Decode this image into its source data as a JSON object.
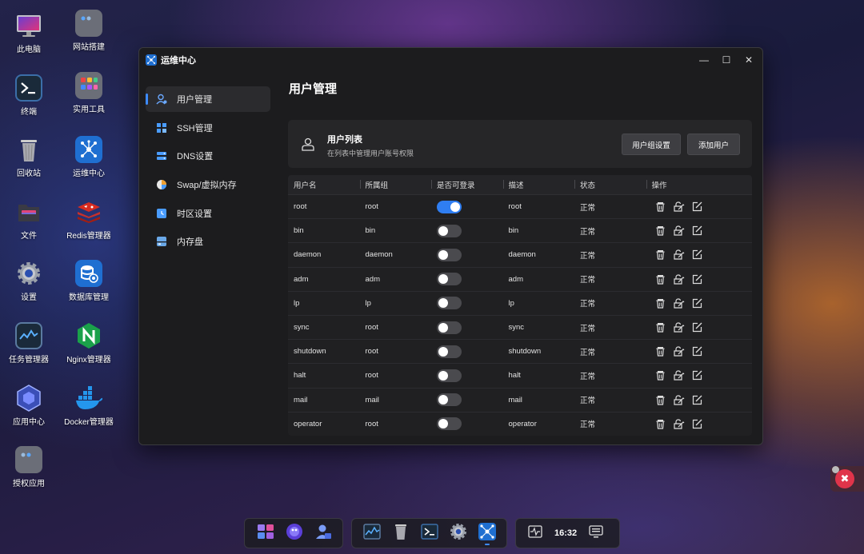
{
  "desktop": {
    "icons": [
      {
        "label": "此电脑"
      },
      {
        "label": "网站搭建"
      },
      {
        "label": "终端"
      },
      {
        "label": "实用工具"
      },
      {
        "label": "回收站"
      },
      {
        "label": "运维中心"
      },
      {
        "label": "文件"
      },
      {
        "label": "Redis管理器"
      },
      {
        "label": "设置"
      },
      {
        "label": "数据库管理"
      },
      {
        "label": "任务管理器"
      },
      {
        "label": "Nginx管理器"
      },
      {
        "label": "应用中心"
      },
      {
        "label": "Docker管理器"
      },
      {
        "label": "授权应用"
      }
    ]
  },
  "window": {
    "title": "运维中心",
    "controls": {
      "minimize": "—",
      "maximize": "☐",
      "close": "✕"
    }
  },
  "sidebar": {
    "items": [
      {
        "label": "用户管理",
        "icon": "user-icon"
      },
      {
        "label": "SSH管理",
        "icon": "ssh-icon"
      },
      {
        "label": "DNS设置",
        "icon": "dns-icon"
      },
      {
        "label": "Swap/虚拟内存",
        "icon": "swap-icon"
      },
      {
        "label": "时区设置",
        "icon": "clock-icon"
      },
      {
        "label": "内存盘",
        "icon": "ramdisk-icon"
      }
    ]
  },
  "main": {
    "page_title": "用户管理",
    "card": {
      "title": "用户列表",
      "subtitle": "在列表中管理用户账号权限",
      "group_button": "用户组设置",
      "add_button": "添加用户"
    },
    "table": {
      "headers": [
        "用户名",
        "所属组",
        "是否可登录",
        "描述",
        "状态",
        "操作"
      ],
      "rows": [
        {
          "name": "root",
          "group": "root",
          "login": true,
          "desc": "root",
          "status": "正常"
        },
        {
          "name": "bin",
          "group": "bin",
          "login": false,
          "desc": "bin",
          "status": "正常"
        },
        {
          "name": "daemon",
          "group": "daemon",
          "login": false,
          "desc": "daemon",
          "status": "正常"
        },
        {
          "name": "adm",
          "group": "adm",
          "login": false,
          "desc": "adm",
          "status": "正常"
        },
        {
          "name": "lp",
          "group": "lp",
          "login": false,
          "desc": "lp",
          "status": "正常"
        },
        {
          "name": "sync",
          "group": "root",
          "login": false,
          "desc": "sync",
          "status": "正常"
        },
        {
          "name": "shutdown",
          "group": "root",
          "login": false,
          "desc": "shutdown",
          "status": "正常"
        },
        {
          "name": "halt",
          "group": "root",
          "login": false,
          "desc": "halt",
          "status": "正常"
        },
        {
          "name": "mail",
          "group": "mail",
          "login": false,
          "desc": "mail",
          "status": "正常"
        },
        {
          "name": "operator",
          "group": "root",
          "login": false,
          "desc": "operator",
          "status": "正常"
        }
      ]
    }
  },
  "taskbar": {
    "time": "16:32"
  },
  "colors": {
    "accent": "#2f7ef2",
    "window_bg": "#1c1c1e",
    "danger": "#e0344a"
  }
}
